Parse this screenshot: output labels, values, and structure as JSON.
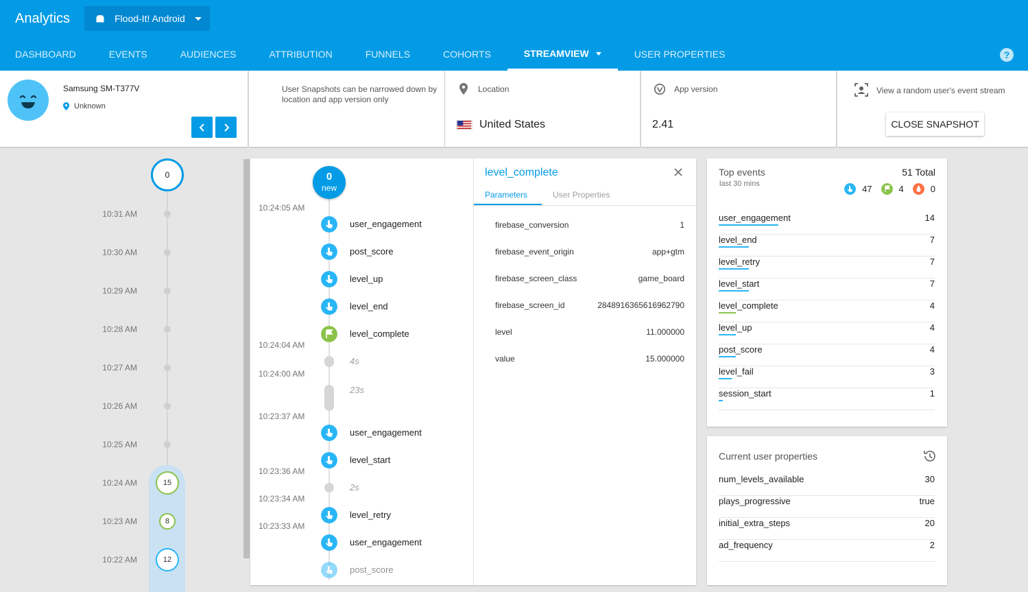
{
  "header": {
    "brand": "Analytics",
    "app_selector": "Flood-It! Android",
    "tabs": [
      {
        "label": "DASHBOARD"
      },
      {
        "label": "EVENTS"
      },
      {
        "label": "AUDIENCES"
      },
      {
        "label": "ATTRIBUTION"
      },
      {
        "label": "FUNNELS"
      },
      {
        "label": "COHORTS"
      },
      {
        "label": "STREAMVIEW"
      },
      {
        "label": "USER PROPERTIES"
      }
    ],
    "active_tab": "STREAMVIEW",
    "help": "?"
  },
  "user": {
    "device": "Samsung SM-T377V",
    "location": "Unknown"
  },
  "hint": "User Snapshots can be narrowed down by location and app version only",
  "location": {
    "label": "Location",
    "value": "United States"
  },
  "app_version": {
    "label": "App version",
    "value": "2.41"
  },
  "random": {
    "label": "View a random user's event stream",
    "button": "CLOSE SNAPSHOT"
  },
  "timeline": {
    "top_count": "0",
    "times": [
      "10:31 AM",
      "10:30 AM",
      "10:29 AM",
      "10:28 AM",
      "10:27 AM",
      "10:26 AM",
      "10:25 AM",
      "10:24 AM",
      "10:23 AM",
      "10:22 AM"
    ],
    "bubbles": [
      "15",
      "8",
      "12"
    ]
  },
  "stream": {
    "new_count": "0",
    "new_label": "new",
    "times": [
      "10:24:05 AM",
      "10:24:04 AM",
      "10:24:00 AM",
      "10:23:37 AM",
      "10:23:36 AM",
      "10:23:34 AM",
      "10:23:33 AM"
    ],
    "events": [
      "user_engagement",
      "post_score",
      "level_up",
      "level_end",
      "level_complete",
      "user_engagement",
      "level_start",
      "level_retry",
      "user_engagement",
      "post_score"
    ],
    "gaps": [
      "4s",
      "23s",
      "2s"
    ]
  },
  "detail": {
    "title": "level_complete",
    "tab_params": "Parameters",
    "tab_props": "User Properties",
    "params": [
      {
        "key": "firebase_conversion",
        "value": "1"
      },
      {
        "key": "firebase_event_origin",
        "value": "app+gtm"
      },
      {
        "key": "firebase_screen_class",
        "value": "game_board"
      },
      {
        "key": "firebase_screen_id",
        "value": "2848916365616962790"
      },
      {
        "key": "level",
        "value": "11.000000"
      },
      {
        "key": "value",
        "value": "15.000000"
      }
    ]
  },
  "top_events": {
    "title": "Top events",
    "subtitle": "last 30 mins",
    "total": "51 Total",
    "badges": [
      {
        "icon": "touch-icon",
        "count": "47",
        "color": "#29b6f6"
      },
      {
        "icon": "flag-icon",
        "count": "4",
        "color": "#8bc34a"
      },
      {
        "icon": "bug-icon",
        "count": "0",
        "color": "#ff7043"
      }
    ],
    "max": 14,
    "rows": [
      {
        "name": "user_engagement",
        "count": 14,
        "color": "#29b6f6"
      },
      {
        "name": "level_end",
        "count": 7,
        "color": "#29b6f6"
      },
      {
        "name": "level_retry",
        "count": 7,
        "color": "#29b6f6"
      },
      {
        "name": "level_start",
        "count": 7,
        "color": "#29b6f6"
      },
      {
        "name": "level_complete",
        "count": 4,
        "color": "#8bc34a"
      },
      {
        "name": "level_up",
        "count": 4,
        "color": "#29b6f6"
      },
      {
        "name": "post_score",
        "count": 4,
        "color": "#29b6f6"
      },
      {
        "name": "level_fail",
        "count": 3,
        "color": "#29b6f6"
      },
      {
        "name": "session_start",
        "count": 1,
        "color": "#29b6f6"
      }
    ]
  },
  "user_props": {
    "title": "Current user properties",
    "rows": [
      {
        "name": "num_levels_available",
        "value": "30"
      },
      {
        "name": "plays_progressive",
        "value": "true"
      },
      {
        "name": "initial_extra_steps",
        "value": "20"
      },
      {
        "name": "ad_frequency",
        "value": "2"
      }
    ]
  }
}
